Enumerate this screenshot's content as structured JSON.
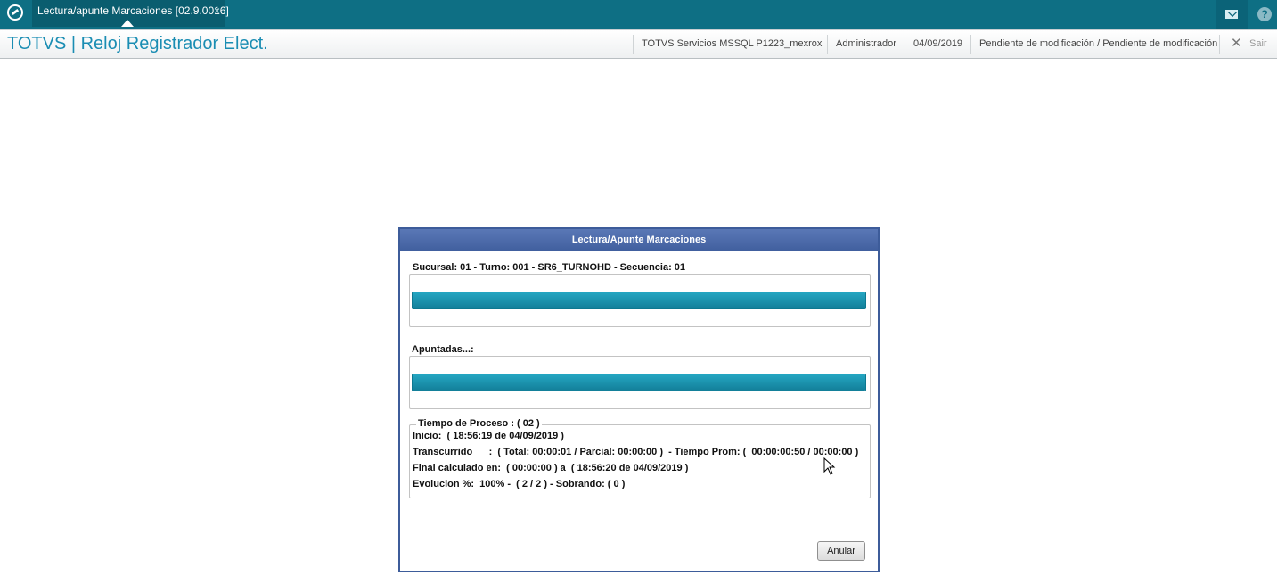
{
  "topbar": {
    "tab_label": "Lectura/apunte Marcaciones [02.9.0016]",
    "tab_close": "×",
    "help_symbol": "?"
  },
  "header": {
    "app_title": "TOTVS | Reloj Registrador Elect.",
    "environment": "TOTVS Servicios MSSQL P1223_mexrox",
    "user": "Administrador",
    "date": "04/09/2019",
    "status": "Pendiente de modificación / Pendiente de modificación",
    "exit_label": "Sair"
  },
  "dialog": {
    "title": "Lectura/Apunte Marcaciones",
    "section1_label": "Sucursal: 01 - Turno: 001 - SR6_TURNOHD - Secuencia: 01",
    "progress1_percent": 100,
    "section2_label": "Apuntadas...:",
    "progress2_percent": 100,
    "process_group": {
      "legend": "Tiempo de Proceso : ( 02 )",
      "inicio": "Inicio:  ( 18:56:19 de 04/09/2019 )",
      "transcurrido": "Transcurrido      :  ( Total: 00:00:01 / Parcial: 00:00:00 )  - Tiempo Prom: (  00:00:00:50 / 00:00:00 )",
      "final": "Final calculado en:  ( 00:00:00 ) a  ( 18:56:20 de 04/09/2019 )",
      "evolucion": "Evolucion %:  100% -  ( 2 / 2 ) - Sobrando: ( 0 )"
    },
    "cancel_label": "Anular"
  },
  "colors": {
    "topbar": "#0e6f84",
    "dialog_title": "#4a68a8",
    "progress": "#1897b4",
    "app_title": "#1a8db3"
  }
}
